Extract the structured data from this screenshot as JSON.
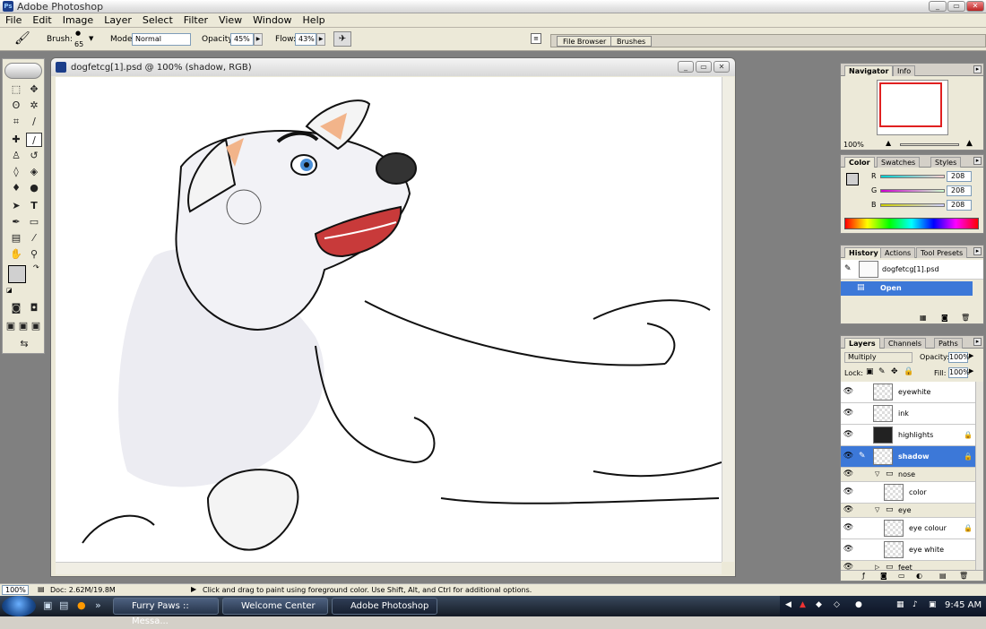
{
  "app_title": "Adobe Photoshop",
  "menu": [
    "File",
    "Edit",
    "Image",
    "Layer",
    "Select",
    "Filter",
    "View",
    "Window",
    "Help"
  ],
  "options": {
    "brush_label": "Brush:",
    "brush_size": "65",
    "mode_label": "Mode:",
    "mode_value": "Normal",
    "opacity_label": "Opacity:",
    "opacity_value": "45%",
    "flow_label": "Flow:",
    "flow_value": "43%"
  },
  "well_tabs": [
    "File Browser",
    "Brushes"
  ],
  "document": {
    "title": "dogfetcg[1].psd @ 100% (shadow, RGB)"
  },
  "navigator": {
    "tabs": [
      "Navigator",
      "Info"
    ],
    "zoom": "100%"
  },
  "color_panel": {
    "tabs": [
      "Color",
      "Swatches",
      "Styles"
    ],
    "r_label": "R",
    "g_label": "G",
    "b_label": "B",
    "r": "208",
    "g": "208",
    "b": "208"
  },
  "history": {
    "tabs": [
      "History",
      "Actions",
      "Tool Presets"
    ],
    "snapshot": "dogfetcg[1].psd",
    "items": [
      "Open"
    ]
  },
  "layers": {
    "tabs": [
      "Layers",
      "Channels",
      "Paths"
    ],
    "blend_mode": "Multiply",
    "opacity_label": "Opacity:",
    "opacity": "100%",
    "lock_label": "Lock:",
    "fill_label": "Fill:",
    "fill": "100%",
    "rows": [
      {
        "name": "eyewhite"
      },
      {
        "name": "ink"
      },
      {
        "name": "highlights"
      },
      {
        "name": "shadow"
      },
      {
        "name": "nose"
      },
      {
        "name": "color"
      },
      {
        "name": "eye"
      },
      {
        "name": "eye colour"
      },
      {
        "name": "eye white"
      },
      {
        "name": "feet"
      }
    ]
  },
  "status": {
    "zoom": "100%",
    "doc": "Doc: 2.62M/19.8M",
    "hint": "Click and drag to paint using foreground color.  Use Shift, Alt, and Ctrl for additional options."
  },
  "taskbar": {
    "buttons": [
      "Furry Paws :: Messa...",
      "Welcome Center",
      "Adobe Photoshop"
    ],
    "time": "9:45 AM"
  },
  "colors": {
    "selection": "#3c78d8",
    "workspace": "#808080",
    "accent_red": "#e02020"
  }
}
